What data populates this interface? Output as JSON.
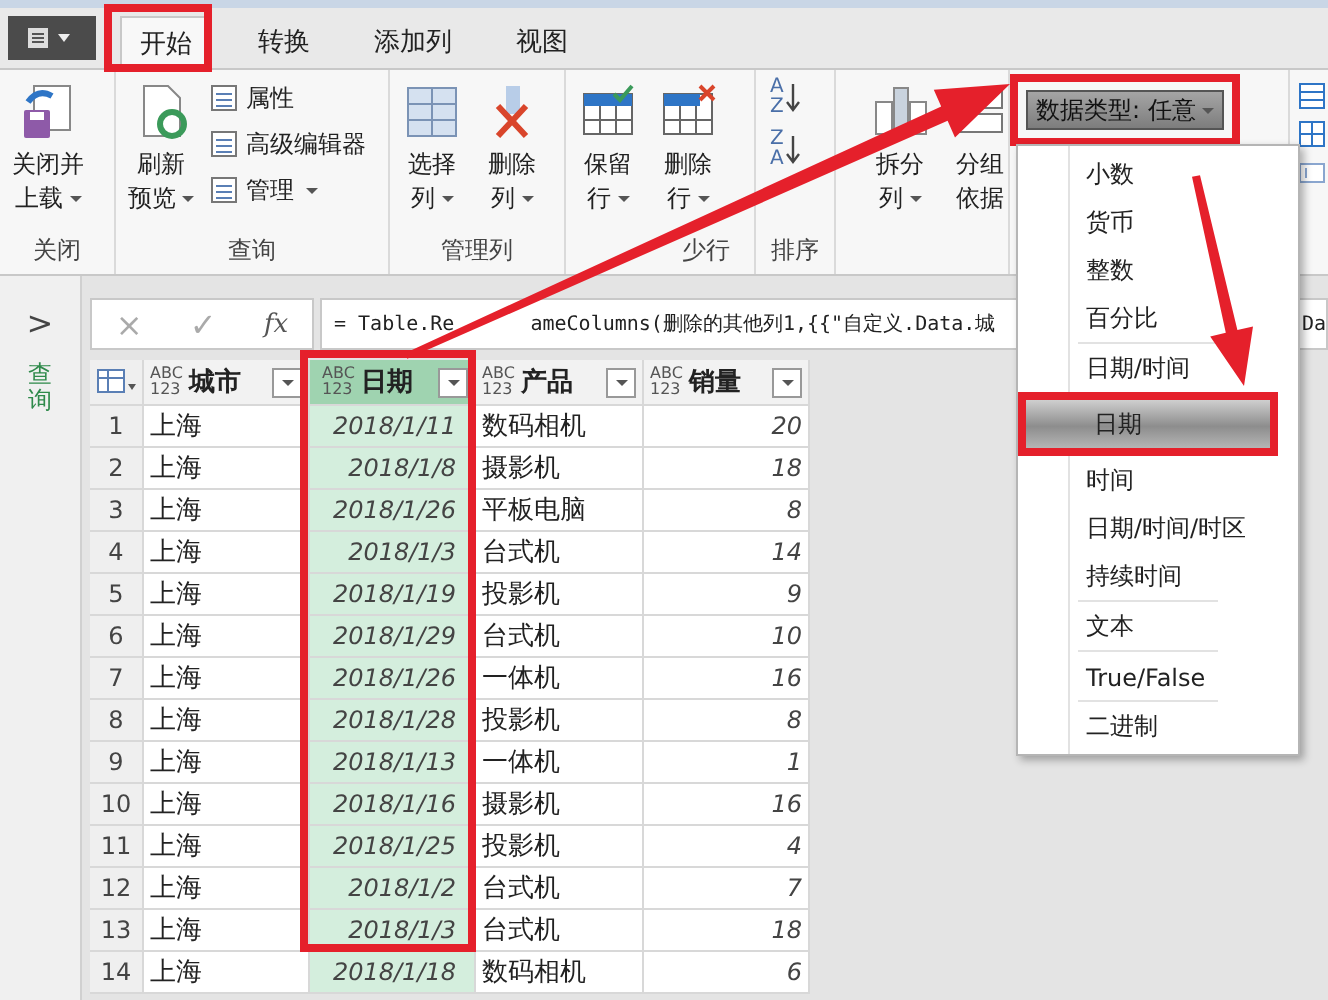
{
  "tabs": [
    {
      "label": "开始",
      "selected": true
    },
    {
      "label": "转换",
      "selected": false
    },
    {
      "label": "添加列",
      "selected": false
    },
    {
      "label": "视图",
      "selected": false
    }
  ],
  "ribbon": {
    "groups": [
      {
        "label": "关闭",
        "buttons": [
          {
            "lines": [
              "关闭并",
              "上载"
            ],
            "dropdown": true
          }
        ]
      },
      {
        "label": "查询",
        "buttons": [
          {
            "lines": [
              "刷新",
              "预览"
            ],
            "dropdown": true
          }
        ],
        "small_buttons": [
          {
            "label": "属性",
            "dropdown": false
          },
          {
            "label": "高级编辑器",
            "dropdown": false
          },
          {
            "label": "管理",
            "dropdown": true
          }
        ]
      },
      {
        "label": "管理列",
        "buttons": [
          {
            "lines": [
              "选择",
              "列"
            ],
            "dropdown": true
          },
          {
            "lines": [
              "删除",
              "列"
            ],
            "dropdown": true
          }
        ]
      },
      {
        "label": "少行",
        "buttons": [
          {
            "lines": [
              "保留",
              "行"
            ],
            "dropdown": true
          },
          {
            "lines": [
              "删除",
              "行"
            ],
            "dropdown": true
          }
        ]
      },
      {
        "label": "排序",
        "sort_buttons": [
          {
            "top": "A",
            "bottom": "Z"
          },
          {
            "top": "Z",
            "bottom": "A"
          }
        ]
      },
      {
        "buttons": [
          {
            "lines": [
              "拆分",
              "列"
            ],
            "dropdown": true
          },
          {
            "lines": [
              "分组",
              "依据"
            ],
            "dropdown": false
          }
        ]
      }
    ],
    "data_type": {
      "label": "数据类型: 任意",
      "expanded": true,
      "options": [
        {
          "label": "小数",
          "selected": false,
          "separator_after": false
        },
        {
          "label": "货币",
          "selected": false,
          "separator_after": false
        },
        {
          "label": "整数",
          "selected": false,
          "separator_after": false
        },
        {
          "label": "百分比",
          "selected": false,
          "separator_after": true
        },
        {
          "label": "日期/时间",
          "selected": false,
          "separator_after": false
        },
        {
          "label": "日期",
          "selected": true,
          "separator_after": false
        },
        {
          "label": "时间",
          "selected": false,
          "separator_after": false
        },
        {
          "label": "日期/时间/时区",
          "selected": false,
          "separator_after": false
        },
        {
          "label": "持续时间",
          "selected": false,
          "separator_after": true
        },
        {
          "label": "文本",
          "selected": false,
          "separator_after": true
        },
        {
          "label": "True/False",
          "selected": false,
          "separator_after": true
        },
        {
          "label": "二进制",
          "selected": false,
          "separator_after": false
        }
      ]
    }
  },
  "nav_pane": {
    "expand": ">",
    "title": "查询"
  },
  "formula_bar": {
    "cancel": "×",
    "confirm": "✓",
    "fx": "fx",
    "text_parts": [
      "= Table.Re",
      "ameColumns(删除的其他列1,{{\"自定义.Data.城"
    ],
    "tail": "Da"
  },
  "table": {
    "columns": [
      {
        "type": [
          "ABC",
          "123"
        ],
        "name": "城市",
        "selected": false
      },
      {
        "type": [
          "ABC",
          "123"
        ],
        "name": "日期",
        "selected": true
      },
      {
        "type": [
          "ABC",
          "123"
        ],
        "name": "产品",
        "selected": false
      },
      {
        "type": [
          "ABC",
          "123"
        ],
        "name": "销量",
        "selected": false
      }
    ],
    "rows": [
      {
        "n": "1",
        "cells": [
          "上海",
          "2018/1/11",
          "数码相机",
          "20"
        ]
      },
      {
        "n": "2",
        "cells": [
          "上海",
          "2018/1/8",
          "摄影机",
          "18"
        ]
      },
      {
        "n": "3",
        "cells": [
          "上海",
          "2018/1/26",
          "平板电脑",
          "8"
        ]
      },
      {
        "n": "4",
        "cells": [
          "上海",
          "2018/1/3",
          "台式机",
          "14"
        ]
      },
      {
        "n": "5",
        "cells": [
          "上海",
          "2018/1/19",
          "投影机",
          "9"
        ]
      },
      {
        "n": "6",
        "cells": [
          "上海",
          "2018/1/29",
          "台式机",
          "10"
        ]
      },
      {
        "n": "7",
        "cells": [
          "上海",
          "2018/1/26",
          "一体机",
          "16"
        ]
      },
      {
        "n": "8",
        "cells": [
          "上海",
          "2018/1/28",
          "投影机",
          "8"
        ]
      },
      {
        "n": "9",
        "cells": [
          "上海",
          "2018/1/13",
          "一体机",
          "1"
        ]
      },
      {
        "n": "10",
        "cells": [
          "上海",
          "2018/1/16",
          "摄影机",
          "16"
        ]
      },
      {
        "n": "11",
        "cells": [
          "上海",
          "2018/1/25",
          "投影机",
          "4"
        ]
      },
      {
        "n": "12",
        "cells": [
          "上海",
          "2018/1/2",
          "台式机",
          "7"
        ]
      },
      {
        "n": "13",
        "cells": [
          "上海",
          "2018/1/3",
          "台式机",
          "18"
        ]
      },
      {
        "n": "14",
        "cells": [
          "上海",
          "2018/1/18",
          "数码相机",
          "6"
        ]
      }
    ]
  }
}
